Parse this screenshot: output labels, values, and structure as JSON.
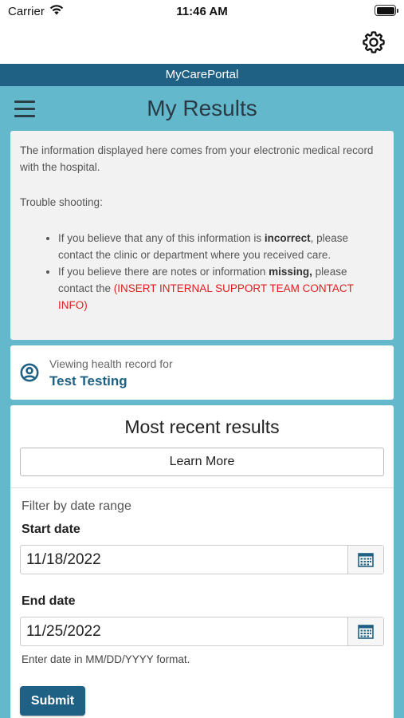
{
  "status_bar": {
    "carrier": "Carrier",
    "time": "11:46 AM"
  },
  "portal": {
    "name": "MyCarePortal"
  },
  "header": {
    "title": "My Results"
  },
  "info": {
    "intro": "The information displayed here comes from your electronic medical record with the hospital.",
    "troubleshooting": "Trouble shooting:",
    "bullet1_pre": "If you believe that any of this information is ",
    "bullet1_bold": "incorrect",
    "bullet1_post": ", please contact the clinic or department where you received care.",
    "bullet2_pre": "If you believe there are notes or information ",
    "bullet2_bold": "missing,",
    "bullet2_post": " please contact the ",
    "bullet2_red": "(INSERT INTERNAL SUPPORT TEAM CONTACT INFO)"
  },
  "record": {
    "label": "Viewing health record for",
    "patient": "Test Testing"
  },
  "results": {
    "title": "Most recent results",
    "learn_more": "Learn More",
    "filter_label": "Filter by date range",
    "start_label": "Start date",
    "start_value": "11/18/2022",
    "end_label": "End date",
    "end_value": "11/25/2022",
    "hint": "Enter date in MM/DD/YYYY format.",
    "submit": "Submit"
  },
  "colors": {
    "brand": "#1f6184",
    "background": "#63b8cc",
    "alert": "#e01e1e"
  },
  "icons": [
    "wifi-icon",
    "battery-icon",
    "gear-icon",
    "hamburger-menu-icon",
    "user-circle-icon",
    "calendar-icon"
  ]
}
